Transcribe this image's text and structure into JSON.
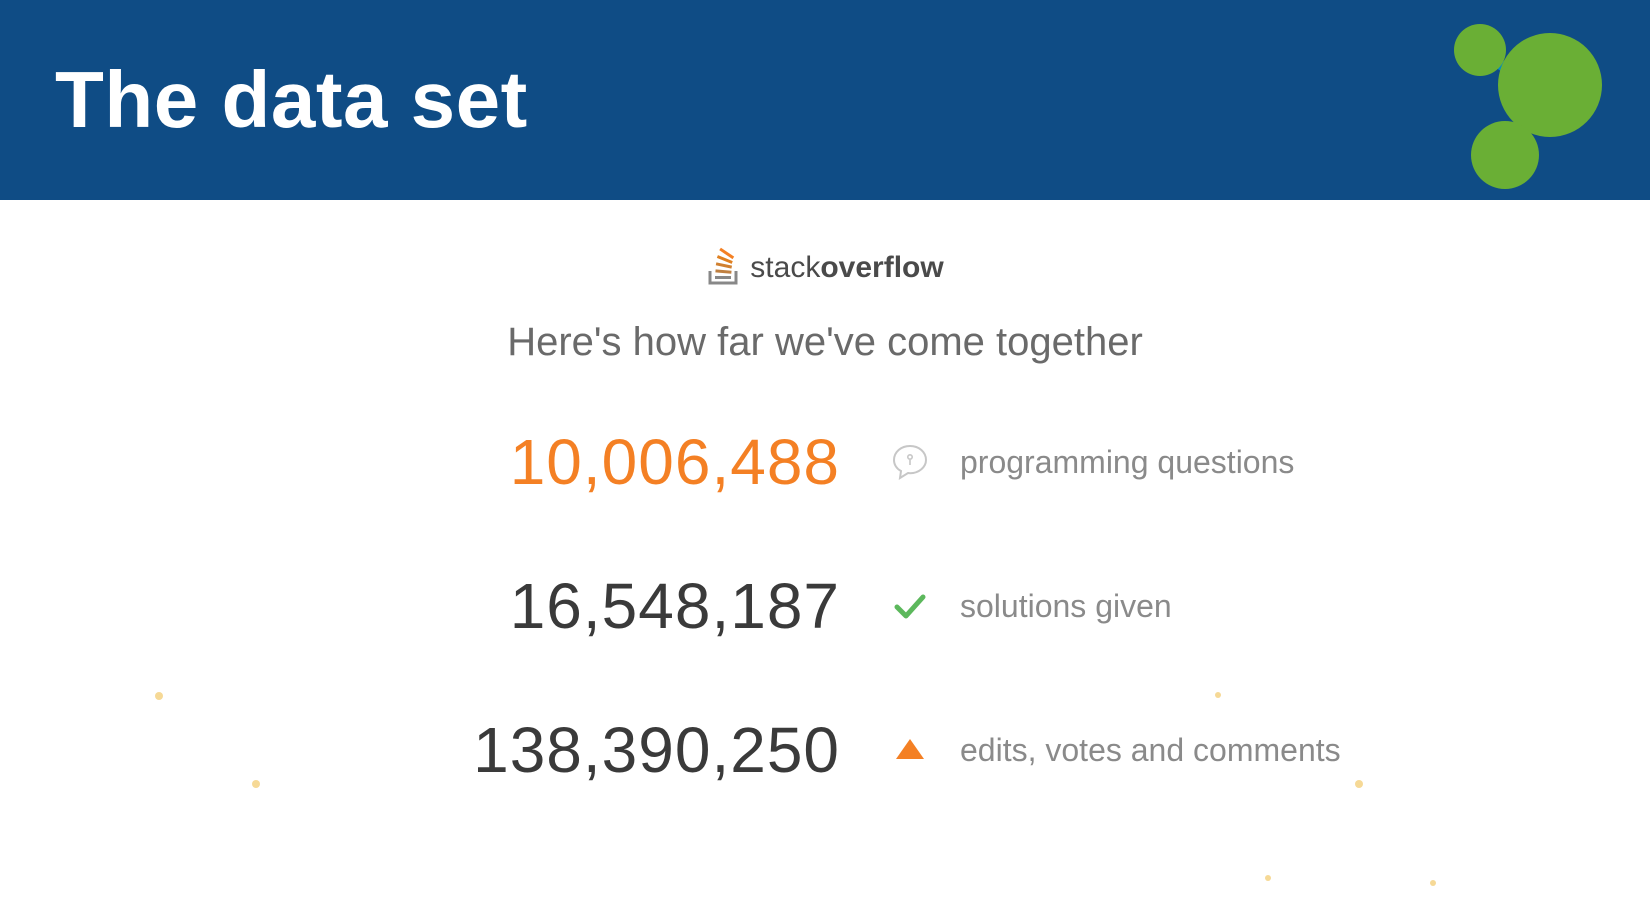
{
  "header": {
    "title": "The data set"
  },
  "brand": {
    "logo_text_regular": "stack",
    "logo_text_bold": "overflow"
  },
  "subtitle": "Here's how far we've come together",
  "stats": [
    {
      "value": "10,006,488",
      "label": "programming questions",
      "icon": "speech-bubble-icon",
      "color": "orange"
    },
    {
      "value": "16,548,187",
      "label": "solutions given",
      "icon": "checkmark-icon",
      "color": "dark"
    },
    {
      "value": "138,390,250",
      "label": "edits, votes and comments",
      "icon": "up-triangle-icon",
      "color": "dark"
    }
  ],
  "colors": {
    "header_bg": "#0f4c85",
    "accent_orange": "#f48024",
    "neo4j_green": "#6aaf35",
    "neo4j_blue": "#008cc1",
    "text_gray": "#6a6a6a",
    "label_gray": "#8a8a8a",
    "check_green": "#5CB85C"
  }
}
